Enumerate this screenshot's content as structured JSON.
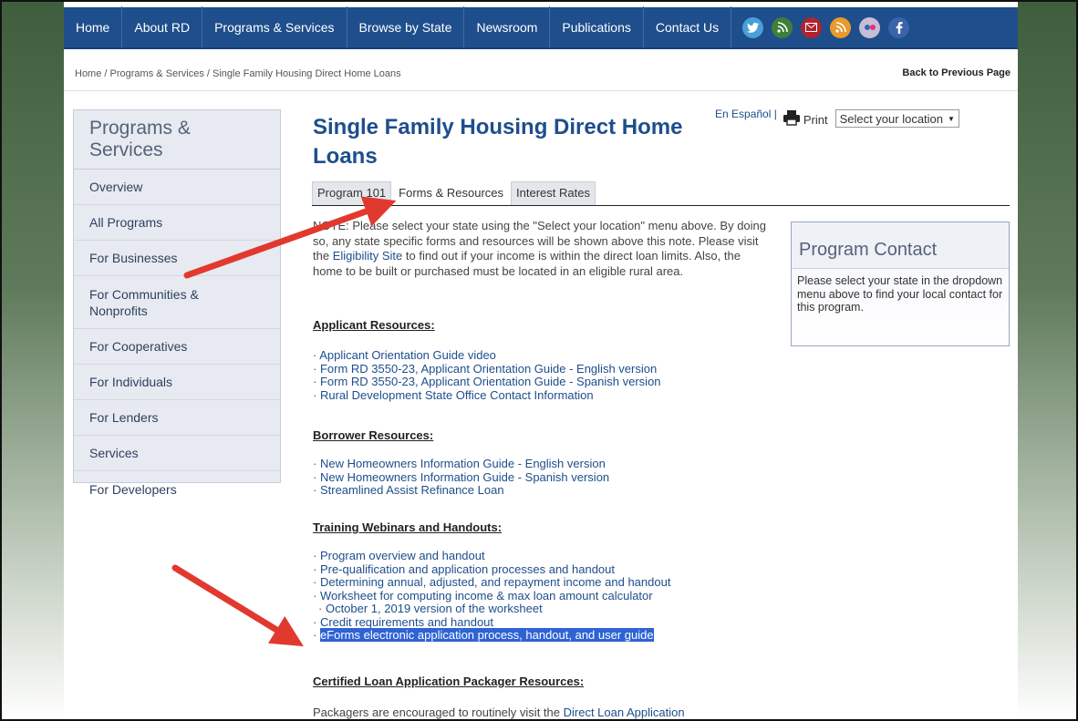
{
  "nav": {
    "items": [
      "Home",
      "About RD",
      "Programs & Services",
      "Browse by State",
      "Newsroom",
      "Publications",
      "Contact Us"
    ],
    "social_icons": [
      {
        "name": "twitter-icon",
        "color": "#4a9fd8",
        "glyph": ""
      },
      {
        "name": "rss-feed-icon",
        "color": "#3f7f3a",
        "glyph": "))"
      },
      {
        "name": "email-icon",
        "color": "#b0232f",
        "glyph": ""
      },
      {
        "name": "rss-icon",
        "color": "#e89a2c",
        "glyph": ""
      },
      {
        "name": "flickr-icon",
        "color": "#c6bdd6",
        "glyph": ""
      },
      {
        "name": "facebook-icon",
        "color": "#3a63ad",
        "glyph": "f"
      }
    ]
  },
  "breadcrumb": "Home / Programs & Services / Single Family Housing Direct Home Loans",
  "back_link": "Back to Previous Page",
  "sidebar": {
    "title": "Programs & Services",
    "items": [
      "Overview",
      "All Programs",
      "For Businesses",
      "For Communities & Nonprofits",
      "For Cooperatives",
      "For Individuals",
      "For Lenders",
      "Services",
      "For Developers"
    ]
  },
  "page": {
    "title_line1": "Single Family Housing Direct Home",
    "title_line2": "Loans",
    "espanol": "En Español |",
    "print": "Print",
    "location_select": "Select your location"
  },
  "tabs": [
    "Program 101",
    "Forms & Resources",
    "Interest Rates"
  ],
  "note": {
    "part1": "NOTE: Please select your state using the \"Select your location\" menu above. By doing so, any state specific forms and resources will be shown above this note. Please visit the ",
    "link": "Eligibility Site",
    "part2": " to find out if your income is within the direct loan limits. Also, the home to be built or purchased must be located in an eligible rural area."
  },
  "sections": {
    "applicant": {
      "title": "Applicant Resources:",
      "items": [
        "Applicant Orientation Guide video",
        "Form RD 3550-23, Applicant Orientation Guide - English version",
        "Form RD 3550-23, Applicant Orientation Guide - Spanish version",
        "Rural Development State Office Contact Information"
      ]
    },
    "borrower": {
      "title": "Borrower Resources:",
      "items": [
        "New Homeowners Information Guide - English version",
        "New Homeowners Information Guide - Spanish version",
        "Streamlined Assist Refinance Loan"
      ]
    },
    "training": {
      "title": "Training Webinars and Handouts:",
      "items": [
        "Program overview and handout",
        "Pre-qualification and application processes and handout",
        "Determining annual, adjusted, and repayment income and handout",
        "Worksheet for computing income & max loan amount calculator",
        "October 1, 2019 version of the worksheet",
        "Credit requirements and handout",
        "eForms electronic application process, handout, and user guide"
      ]
    },
    "packager": {
      "title": "Certified Loan Application Packager Resources:",
      "text_prefix": "Packagers are encouraged to routinely visit the ",
      "text_link": "Direct Loan Application"
    }
  },
  "contact": {
    "title": "Program Contact",
    "text": "Please select your state in the dropdown menu above to find your local contact for this program."
  },
  "colors": {
    "nav_blue": "#1e4e8c",
    "link_blue": "#1e4e8c",
    "highlight": "#2e63d4",
    "arrow_red": "#e2392f"
  }
}
